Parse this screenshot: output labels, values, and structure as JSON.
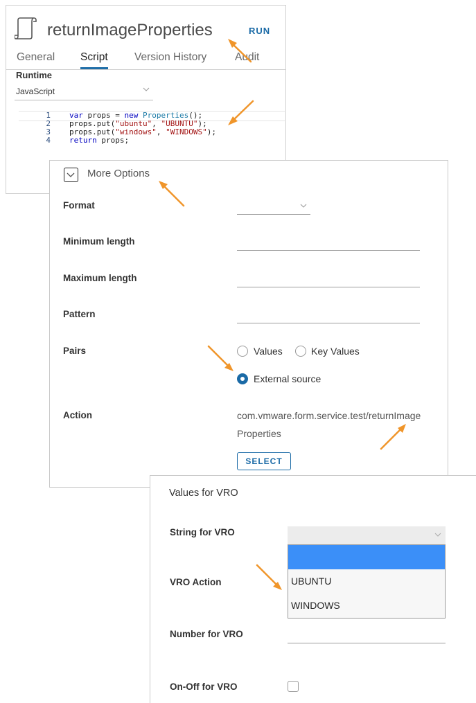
{
  "script_panel": {
    "title": "returnImageProperties",
    "run_label": "RUN",
    "tabs": [
      {
        "label": "General"
      },
      {
        "label": "Script"
      },
      {
        "label": "Version History"
      },
      {
        "label": "Audit"
      }
    ],
    "runtime_label": "Runtime",
    "runtime_value": "JavaScript",
    "code": [
      {
        "num": "1",
        "text": "var props = new Properties();"
      },
      {
        "num": "2",
        "text": "props.put(\"ubuntu\", \"UBUNTU\");"
      },
      {
        "num": "3",
        "text": "props.put(\"windows\", \"WINDOWS\");"
      },
      {
        "num": "4",
        "text": "return props;"
      }
    ]
  },
  "options_panel": {
    "more_options_label": "More Options",
    "format_label": "Format",
    "min_length_label": "Minimum length",
    "max_length_label": "Maximum length",
    "pattern_label": "Pattern",
    "pairs_label": "Pairs",
    "pairs_options": {
      "values": "Values",
      "key_values": "Key Values",
      "external_source": "External source"
    },
    "pairs_selected": "External source",
    "action_label": "Action",
    "action_value_line1": "com.vmware.form.service.test/returnImage",
    "action_value_line2": "Properties",
    "select_button": "SELECT"
  },
  "vro_panel": {
    "title": "Values for VRO",
    "string_label": "String for VRO",
    "action_label": "VRO Action",
    "number_label": "Number for VRO",
    "onoff_label": "On-Off for VRO",
    "dropdown_options": [
      "",
      "UBUNTU",
      "WINDOWS"
    ]
  },
  "colors": {
    "accent": "#1a6aa6",
    "annotation_arrow": "#f0952a",
    "dropdown_selected": "#3b8ff8"
  }
}
